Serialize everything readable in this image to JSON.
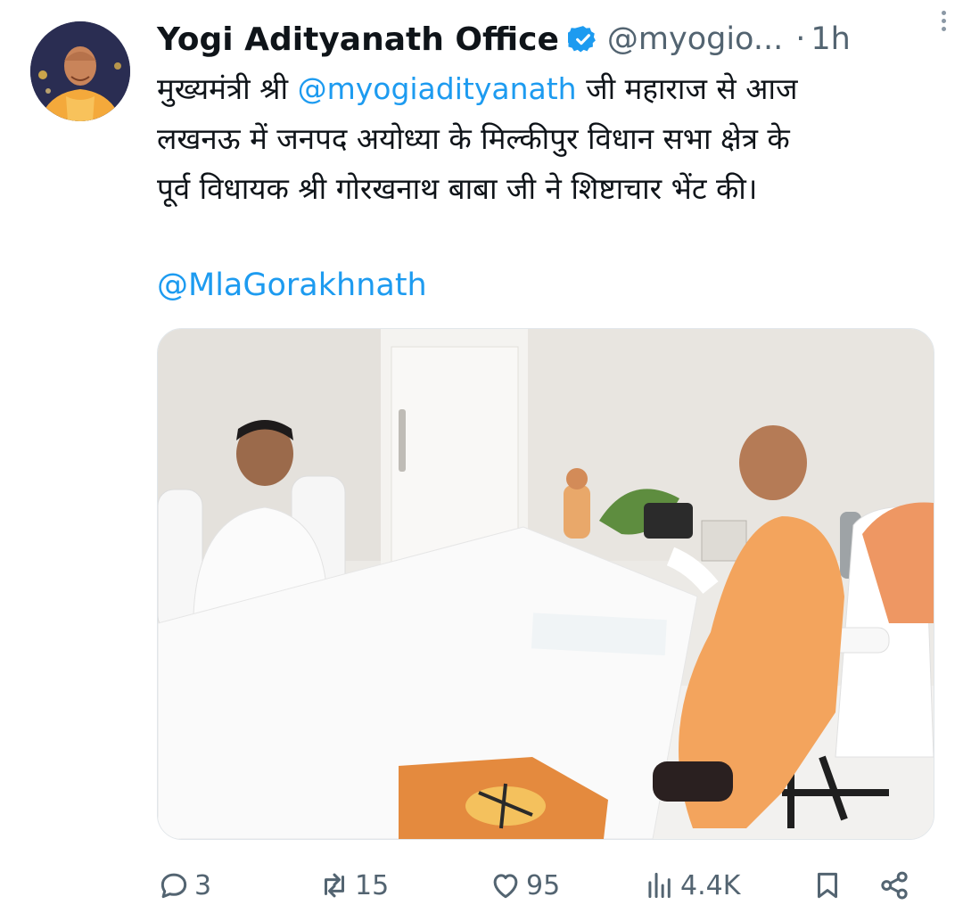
{
  "tweet": {
    "author_name": "Yogi Adityanath Office",
    "handle": "@myogio...",
    "separator": "·",
    "time": "1h",
    "text_lines": [
      {
        "pre": "मुख्यमंत्री श्री ",
        "mention": "@myogiadityanath",
        "post": " जी महाराज से आज"
      },
      "लखनऊ में जनपद अयोध्या के मिल्कीपुर विधान सभा क्षेत्र के",
      "पूर्व विधायक श्री गोरखनाथ बाबा जी ने शिष्टाचार भेंट की।"
    ],
    "mention_line": "@MlaGorakhnath"
  },
  "actions": {
    "replies": "3",
    "reposts": "15",
    "likes": "95",
    "views": "4.4K"
  },
  "icons": {
    "verified": "verified-badge-icon",
    "more": "more-options-icon",
    "reply": "reply-icon",
    "repost": "repost-icon",
    "like": "like-icon",
    "views": "views-icon",
    "bookmark": "bookmark-icon",
    "share": "share-icon"
  },
  "colors": {
    "link": "#1d9bf0",
    "muted": "#536471",
    "text": "#0f1419"
  }
}
